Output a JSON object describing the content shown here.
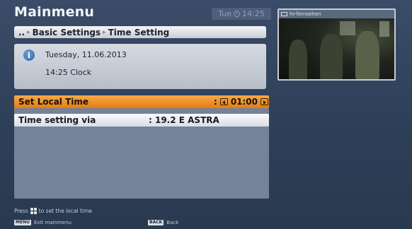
{
  "header": {
    "title": "Mainmenu",
    "clock_day": "Tue",
    "clock_time": "14:25"
  },
  "breadcrumb": {
    "root": "..",
    "level1": "Basic Settings",
    "level2": "Time Setting"
  },
  "info": {
    "date_line": "Tuesday, 11.06.2013",
    "time_line": "14:25 Clock"
  },
  "settings": {
    "local_time": {
      "label": "Set Local Time",
      "colon": ":",
      "value": "01:00"
    },
    "via": {
      "label": "Time setting via",
      "value": ": 19.2 E ASTRA"
    }
  },
  "preview": {
    "channel": "hr-fernsehen"
  },
  "hint": {
    "prefix": "Press",
    "suffix": "to set the local time"
  },
  "footer": {
    "menu_key": "MENU",
    "menu_label": "Exit mainmenu",
    "back_key": "BACK",
    "back_label": "Back"
  },
  "colors": {
    "accent_orange": "#e57d10",
    "background": "#2e3f58",
    "panel": "#75829a"
  }
}
